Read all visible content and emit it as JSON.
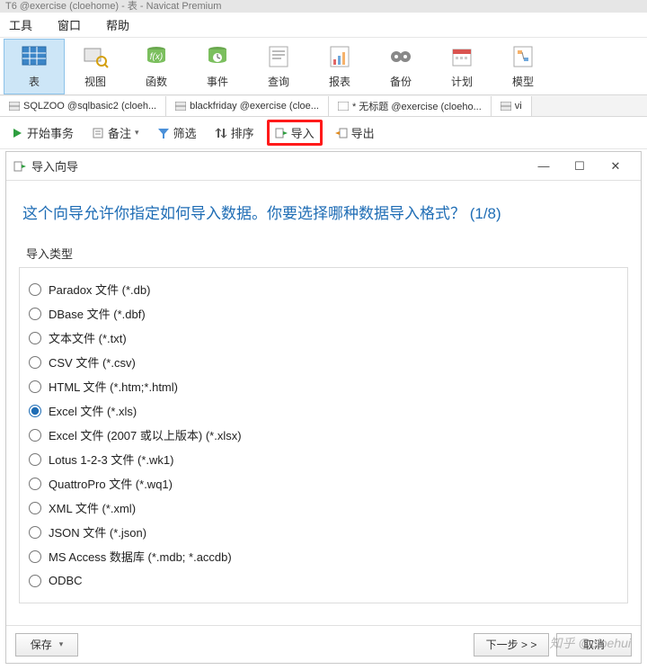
{
  "title": "T6 @exercise (cloehome) - 表 - Navicat Premium",
  "menu": {
    "tools": "工具",
    "window": "窗口",
    "help": "帮助"
  },
  "ribbon": {
    "table": "表",
    "view": "视图",
    "function": "函数",
    "event": "事件",
    "query": "查询",
    "report": "报表",
    "backup": "备份",
    "schedule": "计划",
    "model": "模型"
  },
  "tabs": [
    "SQLZOO @sqlbasic2 (cloeh...",
    "blackfriday @exercise (cloe...",
    "* 无标题 @exercise (cloeho...",
    "vi"
  ],
  "toolbar": {
    "begin_tx": "开始事务",
    "note": "备注",
    "filter": "筛选",
    "sort": "排序",
    "import": "导入",
    "export": "导出"
  },
  "wizard": {
    "window_title": "导入向导",
    "heading": "这个向导允许你指定如何导入数据。你要选择哪种数据导入格式？  (1/8)",
    "group_label": "导入类型",
    "options": [
      "Paradox 文件 (*.db)",
      "DBase 文件 (*.dbf)",
      "文本文件 (*.txt)",
      "CSV 文件 (*.csv)",
      "HTML 文件 (*.htm;*.html)",
      "Excel 文件 (*.xls)",
      "Excel 文件 (2007 或以上版本) (*.xlsx)",
      "Lotus 1-2-3 文件 (*.wk1)",
      "QuattroPro 文件 (*.wq1)",
      "XML 文件 (*.xml)",
      "JSON 文件 (*.json)",
      "MS Access 数据库 (*.mdb; *.accdb)",
      "ODBC"
    ],
    "selected_index": 5,
    "buttons": {
      "save": "保存",
      "next": "下一步 > >",
      "cancel": "取消"
    }
  },
  "watermark": "知乎 @cloehui"
}
